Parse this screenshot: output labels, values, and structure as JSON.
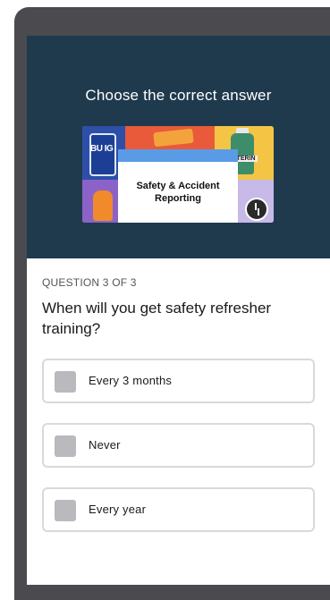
{
  "hero": {
    "title": "Choose the correct answer",
    "thumbnail": {
      "card_text": "Safety & Accident Reporting",
      "can_text": "BU IG",
      "bottle_label": "ISTERIN"
    }
  },
  "question": {
    "counter": "QUESTION 3 OF 3",
    "text": "When will you get safety refresher training?",
    "options": [
      {
        "label": "Every 3 months",
        "checked": false
      },
      {
        "label": "Never",
        "checked": false
      },
      {
        "label": "Every year",
        "checked": false
      }
    ]
  },
  "colors": {
    "hero_bg": "#1f3a4d",
    "device_frame": "#4a4a4f",
    "card_accent": "#5a9be6",
    "checkbox_unchecked": "#b9b9be",
    "option_border": "#d9d9d9"
  },
  "icons": [
    "checkbox-icon",
    "clock-icon"
  ]
}
